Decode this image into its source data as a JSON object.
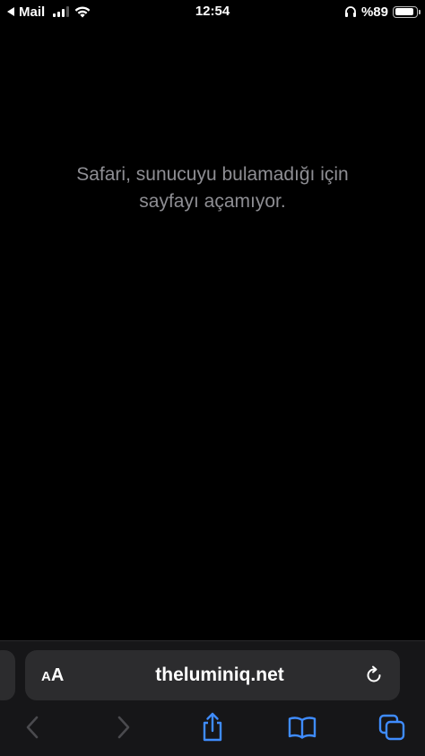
{
  "status_bar": {
    "back_app": "Mail",
    "time": "12:54",
    "battery_text": "%89",
    "battery_level": 0.89
  },
  "page": {
    "error_line1": "Safari, sunucuyu bulamadığı için",
    "error_line2": "sayfayı açamıyor."
  },
  "toolbar": {
    "aa_small": "A",
    "aa_large": "A",
    "url": "theluminiq.net"
  },
  "icons": {
    "back": "chevron-left-icon",
    "forward": "chevron-right-icon",
    "share": "share-icon",
    "bookmarks": "book-icon",
    "tabs": "tabs-icon",
    "reload": "reload-icon"
  },
  "colors": {
    "accent": "#3f8cff",
    "disabled": "#4a4a4e",
    "message": "#8e8e93"
  }
}
